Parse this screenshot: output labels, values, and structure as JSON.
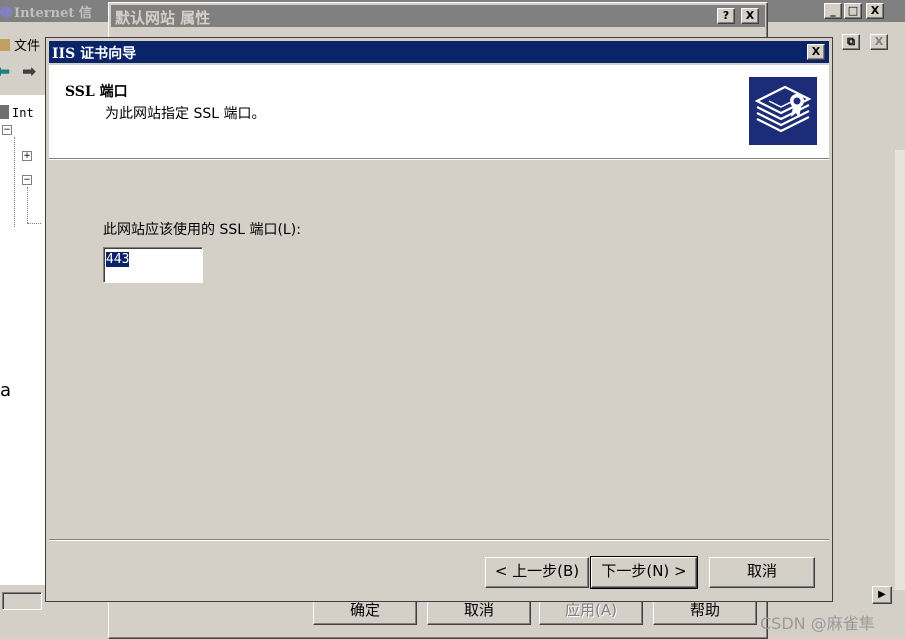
{
  "background_window": {
    "title": "Internet 信",
    "menu_file": "文件",
    "tree_root": "Int"
  },
  "properties_dialog": {
    "title": "默认网站 属性",
    "help_glyph": "?",
    "close_glyph": "X",
    "buttons": {
      "ok": "确定",
      "cancel": "取消",
      "apply": "应用(A)",
      "help": "帮助"
    }
  },
  "wizard": {
    "title": "IIS 证书向导",
    "close_glyph": "X",
    "heading": "SSL 端口",
    "subheading": "为此网站指定 SSL 端口。",
    "port_label": "此网站应该使用的 SSL 端口(L):",
    "port_value": "443",
    "buttons": {
      "back": "< 上一步(B)",
      "next": "下一步(N) >",
      "cancel": "取消"
    }
  },
  "watermark": "CSDN @麻雀隼",
  "colors": {
    "active_titlebar": "#0a246a",
    "inactive_titlebar": "#808080",
    "face": "#d4d0c8",
    "selection": "#0a246a"
  }
}
